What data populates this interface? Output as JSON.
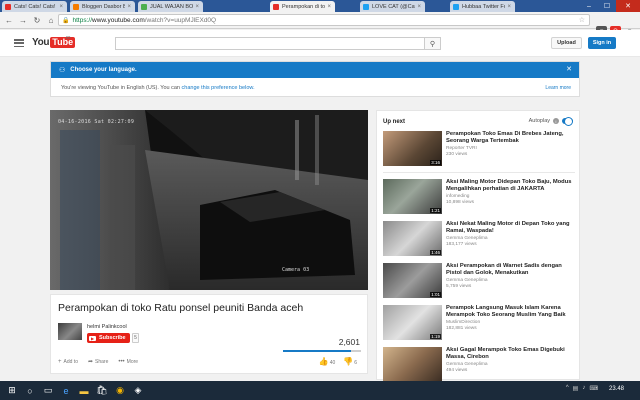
{
  "browser": {
    "tabs": [
      {
        "label": "Cats! Cats! Cats! - Kolin",
        "color": "#e52d27"
      },
      {
        "label": "Bloggen Dasbor Blogge",
        "color": "#f57c00"
      },
      {
        "label": "JUAL WAJAN BOLIC N",
        "color": "#4caf50"
      },
      {
        "label": "Perampokan di toko R",
        "color": "#e52d27"
      },
      {
        "label": "LOVE CAT (@Cat_cuteca",
        "color": "#1da1f2"
      },
      {
        "label": "Hubbaa Twitter Follows",
        "color": "#1da1f2"
      }
    ],
    "active_tab": 3,
    "url_scheme": "https://",
    "url_host": "www.youtube.com",
    "url_path": "/watch?v=uupMJlEXd0Q"
  },
  "header": {
    "logo_you": "You",
    "logo_tube": "Tube",
    "logo_region": "ID",
    "upload_label": "Upload",
    "signin_label": "Sign in"
  },
  "notice": {
    "title": "Choose your language.",
    "body_prefix": "You're viewing YouTube in English (US). You can",
    "body_link": "change this preference below.",
    "learn_more": "Learn more"
  },
  "player": {
    "timestamp": "04-16-2016 Sat 02:27:09",
    "camera": "Camera 03"
  },
  "video": {
    "title": "Perampokan di toko Ratu ponsel peuniti Banda aceh",
    "channel": "helmi Palinkcool",
    "subscribe_label": "Subscribe",
    "subscriber_count": "5",
    "views": "2,601",
    "like_ratio": 0.87,
    "likes": "40",
    "dislikes": "6",
    "actions": {
      "add": "Add to",
      "share": "Share",
      "more": "More"
    }
  },
  "sidebar": {
    "up_next": "Up next",
    "autoplay": "Autoplay",
    "recs": [
      {
        "title": "Perampokan Toko Emas Di Brebes Jateng, Seorang Warga Tertembak",
        "channel": "Reporter TVRI",
        "views": "230 views",
        "duration": "3:16"
      },
      {
        "title": "Aksi Maling Motor Didepan Toko Baju, Modus Mengalihkan perhatian di JAKARTA",
        "channel": "infomeding",
        "views": "10,898 views",
        "duration": "1:21"
      },
      {
        "title": "Aksi Nekat Maling Motor di Depan Toko yang Ramai, Waspada!",
        "channel": "Gemma Geneplima",
        "views": "183,177 views",
        "duration": "1:46"
      },
      {
        "title": "Aksi Perampokan di Warnet Sadis dengan Pistol dan Golok, Menakutkan",
        "channel": "Gemma Geneplima",
        "views": "5,759 views",
        "duration": "1:01"
      },
      {
        "title": "Perampok Langsung Masuk Islam Karena Merampok Toko Seorang Muslim Yang Baik",
        "channel": "MuslimDirection",
        "views": "182,881 views",
        "duration": "1:19"
      },
      {
        "title": "Aksi Gagal Merampok Toko Emas Digebuki Massa, Cirebon",
        "channel": "Gemma Geneplima",
        "views": "494 views",
        "duration": ""
      }
    ]
  },
  "taskbar": {
    "time": "23.48"
  }
}
